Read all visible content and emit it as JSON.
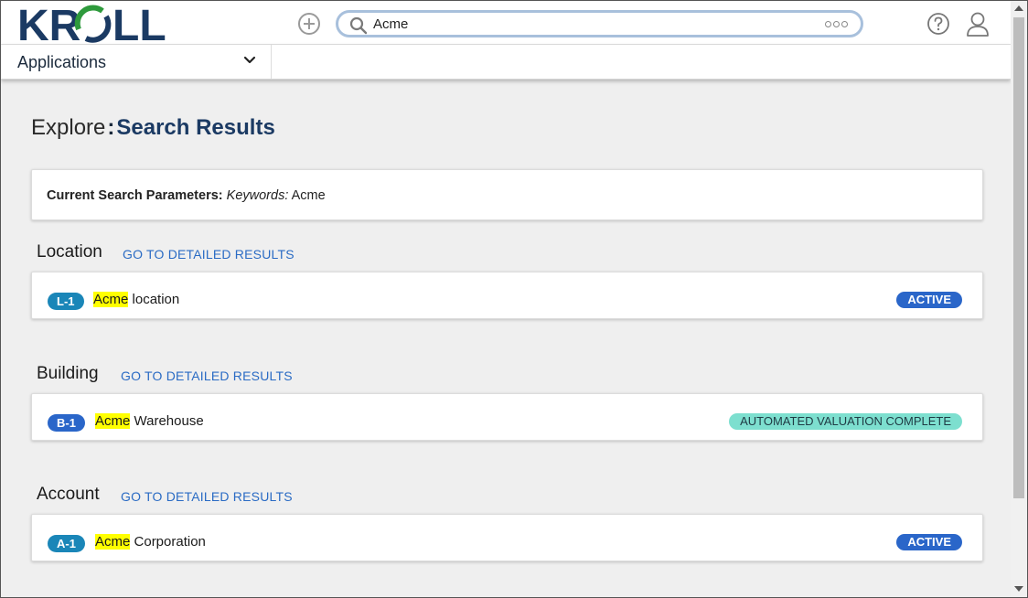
{
  "header": {
    "logo_text": "KROLL",
    "search_value": "Acme",
    "applications_label": "Applications"
  },
  "page": {
    "title_prefix": "Explore",
    "title_separator": ":",
    "title_main": "Search Results"
  },
  "search_params": {
    "label": "Current Search Parameters:",
    "keywords_label": "Keywords:",
    "keywords_value": "Acme"
  },
  "sections": [
    {
      "heading": "Location",
      "link": "GO TO DETAILED RESULTS",
      "result": {
        "id": "L-1",
        "id_color": "#1a86b8",
        "highlight": "Acme",
        "rest": "location",
        "status": "ACTIVE",
        "status_bg": "#2a66c9",
        "status_fg": "#ffffff"
      }
    },
    {
      "heading": "Building",
      "link": "GO TO DETAILED RESULTS",
      "result": {
        "id": "B-1",
        "id_color": "#2a66c9",
        "highlight": "Acme",
        "rest": "Warehouse",
        "status": "AUTOMATED VALUATION COMPLETE",
        "status_bg": "#7ddfcf",
        "status_fg": "#1f3b44"
      }
    },
    {
      "heading": "Account",
      "link": "GO TO DETAILED RESULTS",
      "result": {
        "id": "A-1",
        "id_color": "#1a86b8",
        "highlight": "Acme",
        "rest": "Corporation",
        "status": "ACTIVE",
        "status_bg": "#2a66c9",
        "status_fg": "#ffffff"
      }
    }
  ],
  "icons": {
    "add": "plus-circle-icon",
    "search": "magnifier-icon",
    "more": "ellipsis-icon",
    "help": "question-circle-icon",
    "user": "user-icon",
    "dropdown": "chevron-down-icon"
  }
}
